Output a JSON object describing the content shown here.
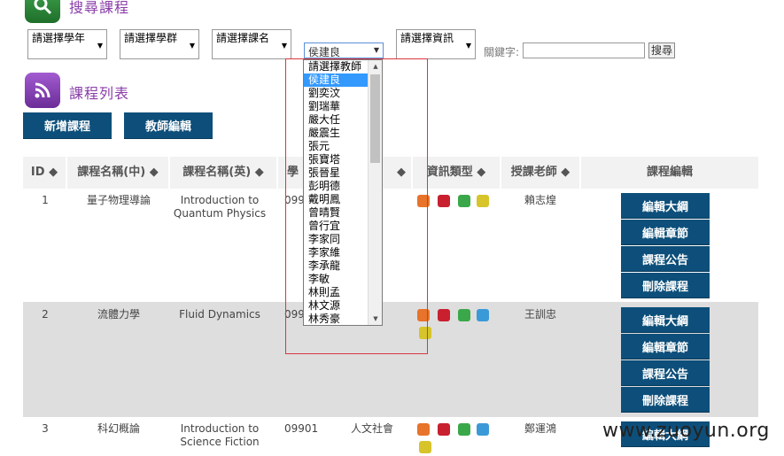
{
  "page": {
    "search_heading": "搜尋課程",
    "list_heading": "課程列表"
  },
  "filters": {
    "year": "請選擇學年",
    "group": "請選擇學群",
    "course": "請選擇課名",
    "teacher": "侯建良",
    "info": "請選擇資訊",
    "keyword_label": "關鍵字:",
    "keyword_value": "",
    "search_button": "搜尋"
  },
  "actions": {
    "add_course": "新增課程",
    "teacher_edit": "教師編輯"
  },
  "table": {
    "headers": [
      "ID",
      "課程名稱(中)",
      "課程名稱(英)",
      "學",
      "",
      "資訊類型",
      "授課老師",
      "課程編輯"
    ],
    "rows": [
      {
        "id": "1",
        "name_zh": "量子物理導論",
        "name_en": "Introduction to Quantum Physics",
        "code": "099",
        "group": "",
        "teacher": "賴志煌",
        "edit_buttons": [
          "編輯大綱",
          "編輯章節",
          "課程公告",
          "刪除課程"
        ]
      },
      {
        "id": "2",
        "name_zh": "流體力學",
        "name_en": "Fluid Dynamics",
        "code": "099",
        "group": "",
        "teacher": "王訓忠",
        "edit_buttons": [
          "編輯大綱",
          "編輯章節",
          "課程公告",
          "刪除課程"
        ]
      },
      {
        "id": "3",
        "name_zh": "科幻概論",
        "name_en": "Introduction to Science Fiction",
        "code": "09901",
        "group": "人文社會",
        "teacher": "鄭運鴻",
        "edit_buttons": [
          "編輯大綱"
        ]
      }
    ]
  },
  "teacher_dropdown": {
    "options": [
      "請選擇教師",
      "侯建良",
      "劉奕汶",
      "劉瑞華",
      "嚴大任",
      "嚴震生",
      "張元",
      "張寶塔",
      "張晉星",
      "彭明德",
      "戴明鳳",
      "曾晴賢",
      "曾行宜",
      "李家同",
      "李家維",
      "李承龍",
      "李敏",
      "林則孟",
      "林文源",
      "林秀豪"
    ],
    "selected_index": 1
  },
  "watermark": "www.zuoyun.org",
  "colors": {
    "accent_purple": "#8a3ea8",
    "button_dark": "#0d4f7a",
    "outline_red": "#d9363e",
    "selected_blue": "#3399ff"
  }
}
